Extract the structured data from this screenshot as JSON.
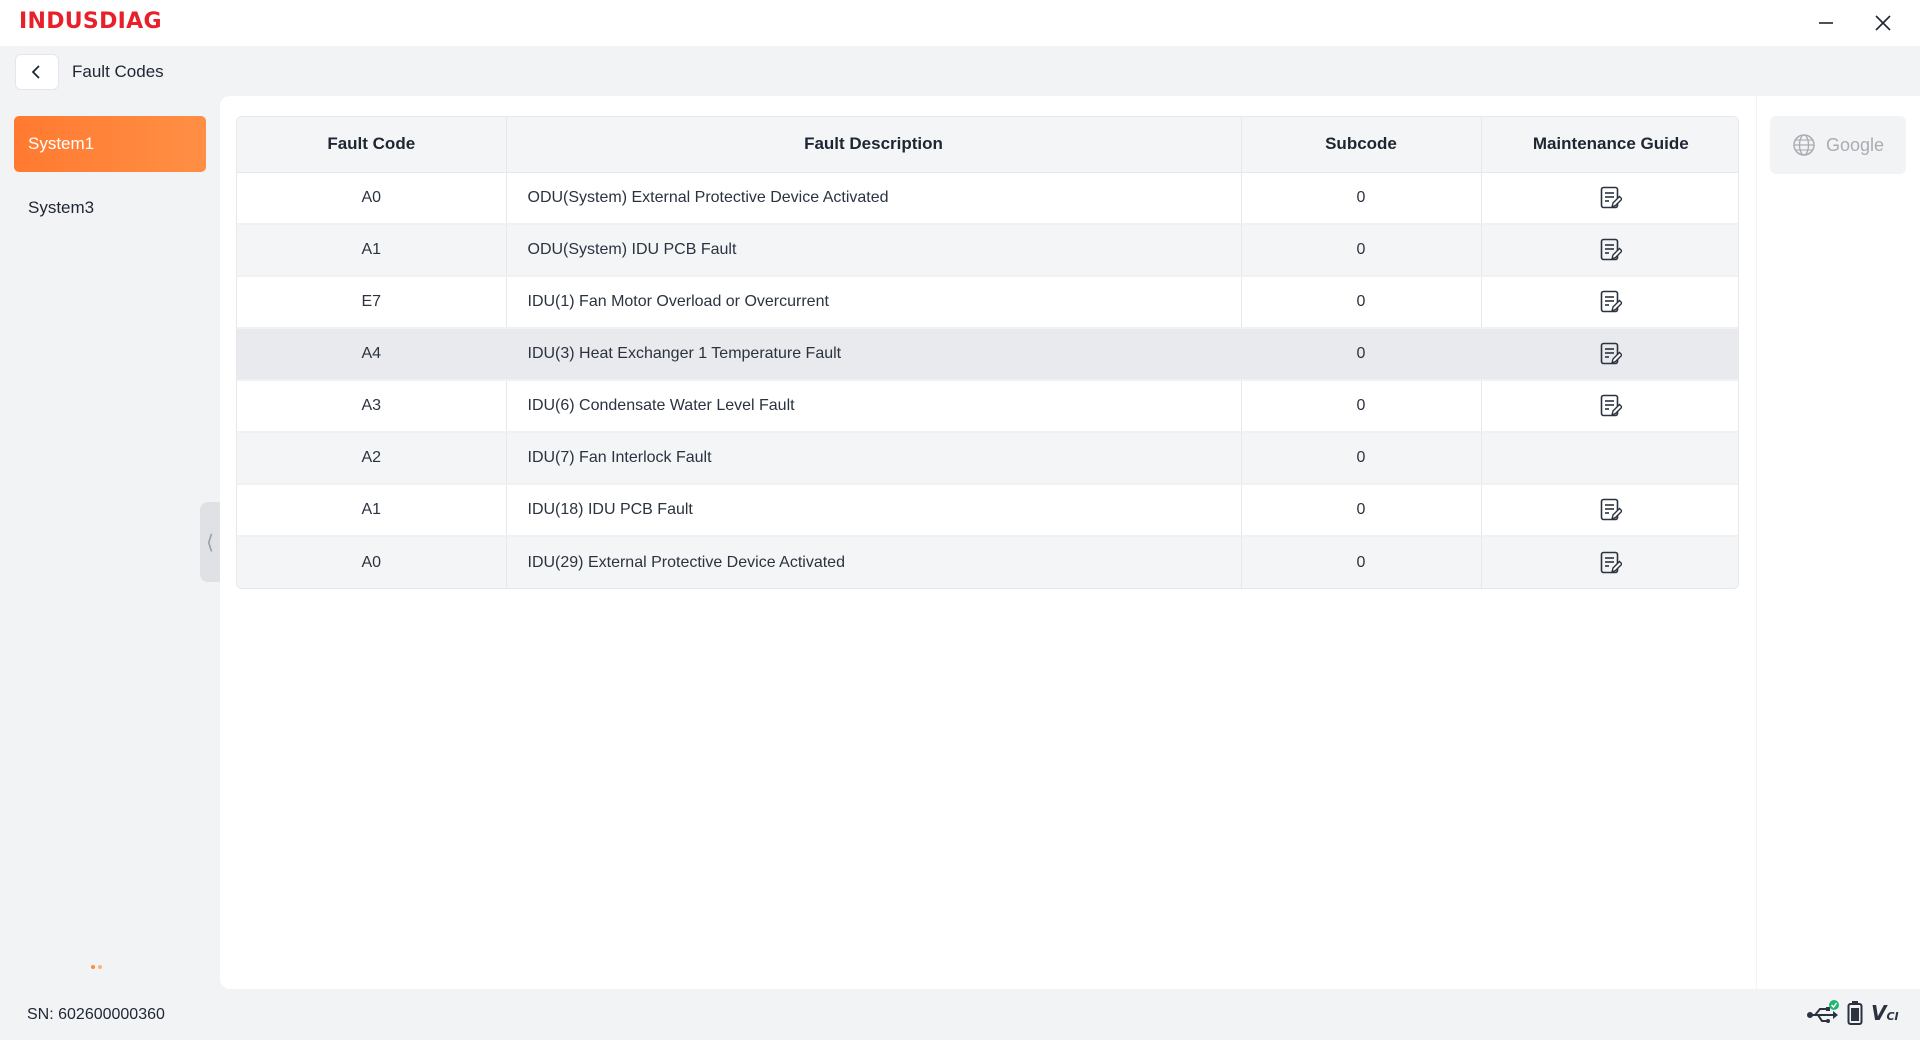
{
  "app": {
    "brand": "INDUSDIAG"
  },
  "window_controls": {
    "minimize_icon": "minimize-icon",
    "close_icon": "close-icon"
  },
  "breadcrumb": {
    "back_icon": "chevron-left-icon",
    "title": "Fault Codes"
  },
  "sidebar": {
    "items": [
      {
        "label": "System1",
        "active": true
      },
      {
        "label": "System3",
        "active": false
      }
    ],
    "accent_color": "#ff7a30"
  },
  "table": {
    "headers": [
      "Fault Code",
      "Fault Description",
      "Subcode",
      "Maintenance Guide"
    ],
    "rows": [
      {
        "code": "A0",
        "description": "ODU(System) External Protective Device Activated",
        "subcode": "0",
        "has_guide": true
      },
      {
        "code": "A1",
        "description": "ODU(System) IDU PCB Fault",
        "subcode": "0",
        "has_guide": true
      },
      {
        "code": "E7",
        "description": "IDU(1)  Fan Motor Overload or Overcurrent",
        "subcode": "0",
        "has_guide": true
      },
      {
        "code": "A4",
        "description": "IDU(3)  Heat Exchanger 1 Temperature Fault",
        "subcode": "0",
        "has_guide": true,
        "selected": true
      },
      {
        "code": "A3",
        "description": "IDU(6)  Condensate Water Level Fault",
        "subcode": "0",
        "has_guide": true
      },
      {
        "code": "A2",
        "description": "IDU(7)  Fan Interlock Fault",
        "subcode": "0",
        "has_guide": false
      },
      {
        "code": "A1",
        "description": "IDU(18)  IDU PCB Fault",
        "subcode": "0",
        "has_guide": true
      },
      {
        "code": "A0",
        "description": "IDU(29)  External Protective Device Activated",
        "subcode": "0",
        "has_guide": true
      }
    ]
  },
  "google_button": {
    "label": "Google",
    "icon": "globe-icon",
    "enabled": false
  },
  "status": {
    "sn": "SN: 602600000360",
    "icons": [
      "usb-connected-icon",
      "battery-icon",
      "vci-icon"
    ],
    "vci_label": "V",
    "vci_sub": "CI"
  },
  "colors": {
    "brand_red": "#e8202a",
    "accent_orange": "#ff7a30",
    "connected_green": "#22b573"
  }
}
